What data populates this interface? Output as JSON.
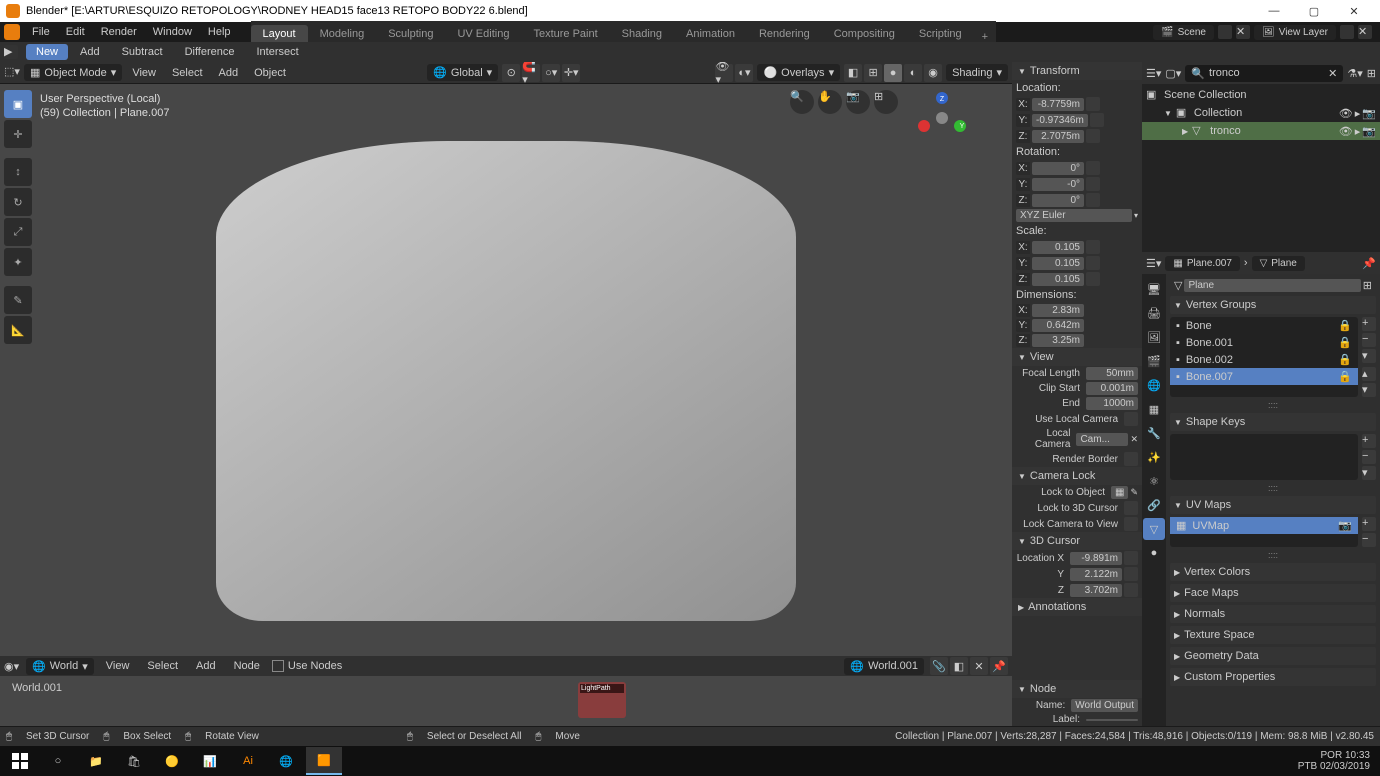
{
  "window": {
    "titlebar_prefix": "Blender* ",
    "filepath": "[E:\\ARTUR\\ESQUIZO RETOPOLOGY\\RODNEY HEAD15 face13 RETOPO BODY22 6.blend]"
  },
  "top_menu": [
    "File",
    "Edit",
    "Render",
    "Window",
    "Help"
  ],
  "workspaces": {
    "tabs": [
      "Layout",
      "Modeling",
      "Sculpting",
      "UV Editing",
      "Texture Paint",
      "Shading",
      "Animation",
      "Rendering",
      "Compositing",
      "Scripting"
    ],
    "active": "Layout"
  },
  "scene_selector": {
    "scene": "Scene",
    "view_layer": "View Layer"
  },
  "viewport_header": {
    "mode": "Object Mode",
    "menus": [
      "View",
      "Select",
      "Add",
      "Object"
    ],
    "orientation": "Global",
    "overlays_label": "Overlays",
    "shading_label": "Shading"
  },
  "boolean_bar": {
    "new": "New",
    "add": "Add",
    "subtract": "Subtract",
    "difference": "Difference",
    "intersect": "Intersect"
  },
  "viewport_overlay": {
    "line1": "User Perspective (Local)",
    "line2": "(59) Collection | Plane.007"
  },
  "n_panel": {
    "transform_hdr": "Transform",
    "location_label": "Location:",
    "loc": {
      "x": "-8.7759m",
      "y": "-0.97346m",
      "z": "2.7075m"
    },
    "rotation_label": "Rotation:",
    "rot": {
      "x": "0°",
      "y": "-0°",
      "z": "0°"
    },
    "rot_mode": "XYZ Euler",
    "scale_label": "Scale:",
    "scale": {
      "x": "0.105",
      "y": "0.105",
      "z": "0.105"
    },
    "dim_label": "Dimensions:",
    "dim": {
      "x": "2.83m",
      "y": "0.642m",
      "z": "3.25m"
    },
    "view_hdr": "View",
    "focal_label": "Focal Length",
    "focal": "50mm",
    "clip_start_label": "Clip Start",
    "clip_start": "0.001m",
    "clip_end_label": "End",
    "clip_end": "1000m",
    "use_local_cam": "Use Local Camera",
    "local_cam": "Local Camera",
    "cam_val": "Cam...",
    "render_border": "Render Border",
    "camera_lock_hdr": "Camera Lock",
    "lock_to_obj": "Lock to Object",
    "lock_cursor": "Lock to 3D Cursor",
    "lock_view": "Lock Camera to View",
    "cursor_hdr": "3D Cursor",
    "cursor_loc_x_label": "Location X",
    "cursor_x": "-9.891m",
    "cursor_y": "2.122m",
    "cursor_z": "3.702m",
    "annotations_hdr": "Annotations",
    "node_hdr": "Node",
    "node_name_label": "Name:",
    "node_name": "World Output",
    "node_label_label": "Label:"
  },
  "outliner": {
    "search": "tronco",
    "scene_collection": "Scene Collection",
    "collection": "Collection",
    "item": "tronco"
  },
  "prop_header": {
    "left": "Plane.007",
    "right": "Plane"
  },
  "prop_object_field": "Plane",
  "vertex_groups": {
    "hdr": "Vertex Groups",
    "items": [
      "Bone",
      "Bone.001",
      "Bone.002",
      "Bone.007"
    ],
    "selected": 3
  },
  "shape_keys_hdr": "Shape Keys",
  "uv_maps": {
    "hdr": "UV Maps",
    "item": "UVMap"
  },
  "collapsed_sections": [
    "Vertex Colors",
    "Face Maps",
    "Normals",
    "Texture Space",
    "Geometry Data",
    "Custom Properties"
  ],
  "node_editor": {
    "menus": [
      "View",
      "Select",
      "Add",
      "Node"
    ],
    "use_nodes": "Use Nodes",
    "type_label": "World",
    "world_name": "World.001",
    "node_name": "LightPath"
  },
  "statusbar": {
    "left": [
      "Set 3D Cursor",
      "Box Select",
      "Rotate View",
      "Select or Deselect All",
      "Move"
    ],
    "right": "Collection | Plane.007 | Verts:28,287 | Faces:24,584 | Tris:48,916 | Objects:0/119 | Mem: 98.8 MiB | v2.80.45"
  },
  "taskbar": {
    "lang": "POR",
    "layout": "PTB",
    "time": "10:33",
    "date": "02/03/2019"
  }
}
